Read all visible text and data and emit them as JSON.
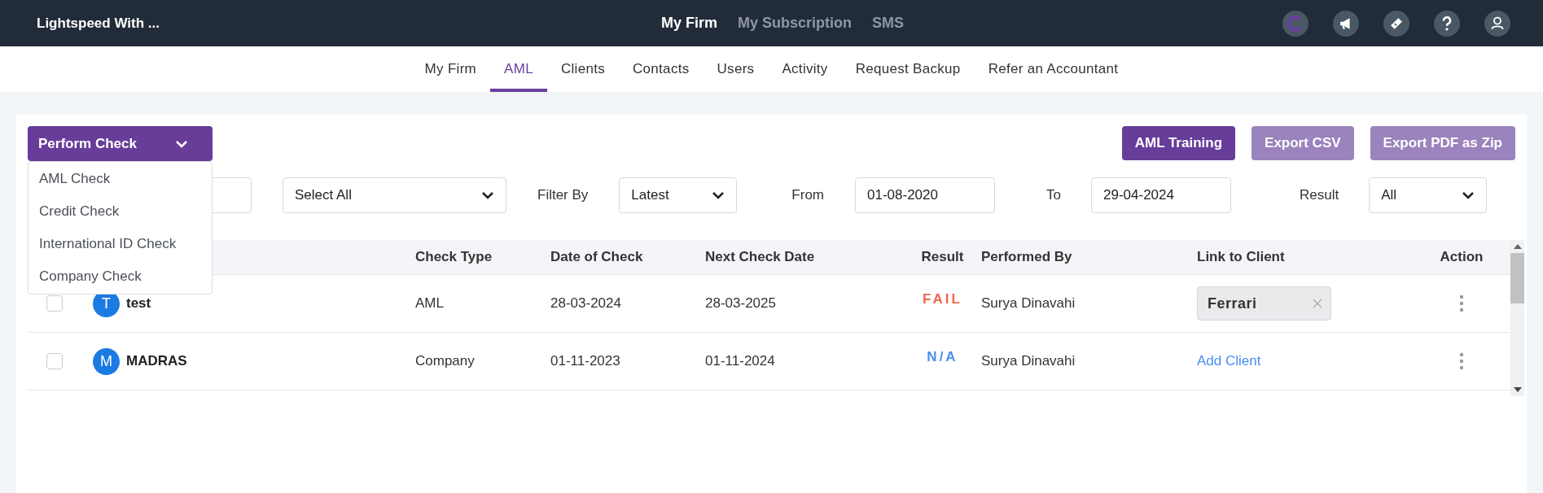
{
  "topbar": {
    "brand": "Lightspeed With ...",
    "links": [
      {
        "label": "My Firm",
        "selected": true
      },
      {
        "label": "My Subscription",
        "selected": false
      },
      {
        "label": "SMS",
        "selected": false
      }
    ]
  },
  "tabs": [
    {
      "label": "My Firm",
      "selected": false
    },
    {
      "label": "AML",
      "selected": true
    },
    {
      "label": "Clients",
      "selected": false
    },
    {
      "label": "Contacts",
      "selected": false
    },
    {
      "label": "Users",
      "selected": false
    },
    {
      "label": "Activity",
      "selected": false
    },
    {
      "label": "Request Backup",
      "selected": false
    },
    {
      "label": "Refer an Accountant",
      "selected": false
    }
  ],
  "perform_check": {
    "label": "Perform Check",
    "expanded": true,
    "options": [
      "AML Check",
      "Credit Check",
      "International ID Check",
      "Company Check"
    ]
  },
  "buttons": [
    {
      "label": "AML Training",
      "disabled": false
    },
    {
      "label": "Export CSV",
      "disabled": true
    },
    {
      "label": "Export PDF as Zip",
      "disabled": true
    }
  ],
  "filters": {
    "category": "Select All",
    "filter_by_label": "Filter By",
    "filter_by": "Latest",
    "from_label": "From",
    "from": "01-08-2020",
    "to_label": "To",
    "to": "29-04-2024",
    "result_label": "Result",
    "result": "All"
  },
  "table": {
    "columns": [
      "Check Type",
      "Date of Check",
      "Next Check Date",
      "Result",
      "Performed By",
      "Link to Client",
      "Action"
    ],
    "rows": [
      {
        "checked": false,
        "initial": "T",
        "name": "test",
        "check_type": "AML",
        "date": "28-03-2024",
        "next_date": "28-03-2025",
        "result": {
          "kind": "fail",
          "text": "FAIL"
        },
        "performed_by": "Surya Dinavahi",
        "link": {
          "kind": "tag",
          "text": "Ferrari"
        }
      },
      {
        "checked": false,
        "initial": "M",
        "name": "MADRAS",
        "check_type": "Company",
        "date": "01-11-2023",
        "next_date": "01-11-2024",
        "result": {
          "kind": "na",
          "text": "N/A"
        },
        "performed_by": "Surya Dinavahi",
        "link": {
          "kind": "link",
          "text": "Add Client"
        }
      }
    ]
  }
}
